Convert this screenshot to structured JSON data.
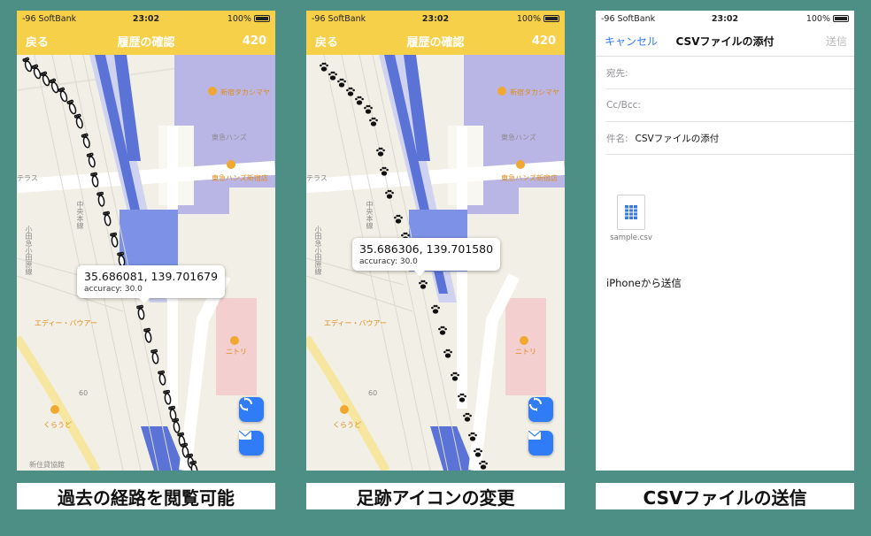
{
  "status": {
    "carrier": "-96 SoftBank",
    "time": "23:02",
    "battery": "100%"
  },
  "panel1": {
    "back": "戻る",
    "title": "履歴の確認",
    "count": "420",
    "coords": "35.686081, 139.701679",
    "accuracy": "accuracy: 30.0",
    "icon_style": "footprint-icon"
  },
  "panel2": {
    "back": "戻る",
    "title": "履歴の確認",
    "count": "420",
    "coords": "35.686306, 139.701580",
    "accuracy": "accuracy: 30.0",
    "icon_style": "paw-print-icon"
  },
  "map_labels": {
    "shinjuku_takashimaya": "新宿タカシマヤ",
    "tokyu_hands_faint": "東急ハンズ",
    "tokyu_hands": "東急ハンズ新宿店",
    "terrace": "テラス",
    "chuo_line": "中央本線",
    "odakyu_line": "小田急小田原線",
    "eddie_bauer": "エディー・バウアー",
    "nitori": "ニトリ",
    "kurauto": "くらうど",
    "number_60": "60",
    "shinjuku_kaijo": "新住貸協館"
  },
  "mail": {
    "cancel": "キャンセル",
    "title": "CSVファイルの添付",
    "send": "送信",
    "to_label": "宛先:",
    "ccbcc_label": "Cc/Bcc:",
    "subject_label": "件名:",
    "subject_value": "CSVファイルの添付",
    "attachment_name": "sample.csv",
    "body": "iPhoneから送信"
  },
  "captions": [
    "過去の経路を閲覧可能",
    "足跡アイコンの変更",
    "CSVファイルの送信"
  ],
  "colors": {
    "background": "#4e8f85",
    "navbar": "#f7d04a",
    "accent": "#2f7cf6",
    "rail": "#5b73d6"
  }
}
